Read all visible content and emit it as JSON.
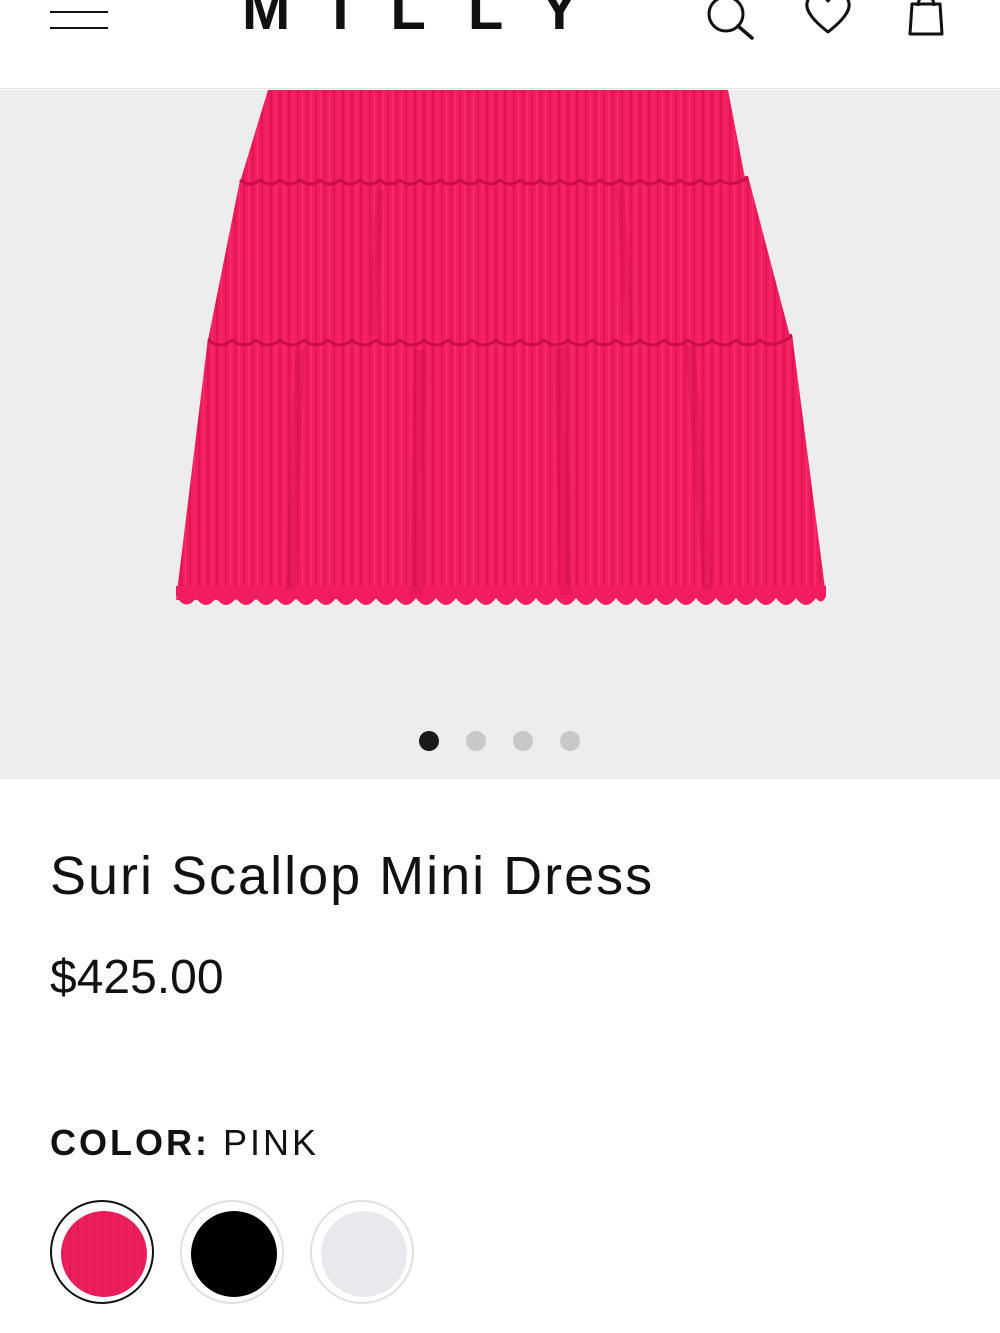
{
  "header": {
    "logo": "MILLY",
    "icons": [
      "menu-icon",
      "search-icon",
      "heart-icon",
      "bag-icon"
    ]
  },
  "gallery": {
    "image_alt": "Suri Scallop Mini Dress in pink",
    "slides_count": 4,
    "active_slide": 1
  },
  "product": {
    "name": "Suri Scallop Mini Dress",
    "price": "$425.00",
    "color_label": "COLOR:",
    "color_value": "PINK",
    "swatches": [
      {
        "name": "pink",
        "color": "#ee1e5c",
        "selected": true
      },
      {
        "name": "black",
        "color": "#000000",
        "selected": false
      },
      {
        "name": "white",
        "color": "#e9e8ec",
        "selected": false
      }
    ]
  }
}
